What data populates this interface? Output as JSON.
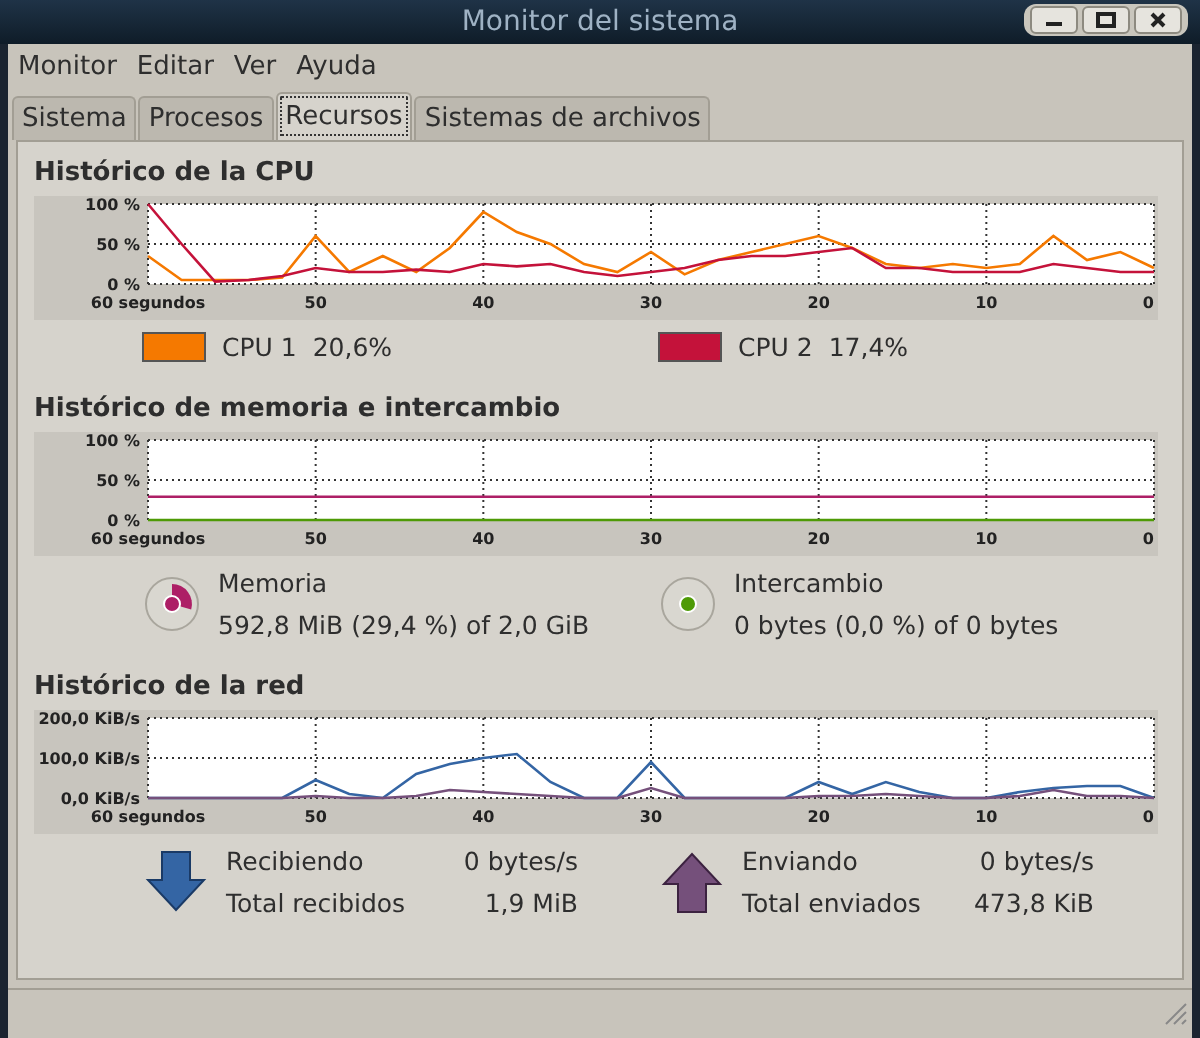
{
  "window": {
    "title": "Monitor del sistema"
  },
  "menu": [
    "Monitor",
    "Editar",
    "Ver",
    "Ayuda"
  ],
  "tabs": [
    {
      "label": "Sistema",
      "selected": false
    },
    {
      "label": "Procesos",
      "selected": false
    },
    {
      "label": "Recursos",
      "selected": true
    },
    {
      "label": "Sistemas de archivos",
      "selected": false
    }
  ],
  "sections": [
    {
      "kind": "cpu",
      "title": "Histórico de la CPU",
      "chart_data": {
        "type": "line",
        "grid": true,
        "x": [
          60,
          58,
          56,
          54,
          52,
          50,
          48,
          46,
          44,
          42,
          40,
          38,
          36,
          34,
          32,
          30,
          28,
          26,
          24,
          22,
          20,
          18,
          16,
          14,
          12,
          10,
          8,
          6,
          4,
          2,
          0
        ],
        "xlim": [
          60,
          0
        ],
        "ylim": [
          0,
          100
        ],
        "xticks": [
          {
            "value": 60,
            "label": "60 segundos"
          },
          {
            "value": 50,
            "label": "50"
          },
          {
            "value": 40,
            "label": "40"
          },
          {
            "value": 30,
            "label": "30"
          },
          {
            "value": 20,
            "label": "20"
          },
          {
            "value": 10,
            "label": "10"
          },
          {
            "value": 0,
            "label": "0"
          }
        ],
        "yticks": [
          {
            "value": 0,
            "label": "0 %"
          },
          {
            "value": 50,
            "label": "50 %"
          },
          {
            "value": 100,
            "label": "100 %"
          }
        ],
        "series": [
          {
            "name": "CPU 1",
            "color": "#f57900",
            "values": [
              35,
              5,
              5,
              5,
              8,
              60,
              15,
              35,
              15,
              45,
              90,
              65,
              50,
              25,
              15,
              40,
              12,
              30,
              40,
              50,
              60,
              45,
              25,
              20,
              25,
              20,
              25,
              60,
              30,
              40,
              20
            ]
          },
          {
            "name": "CPU 2",
            "color": "#c4123a",
            "values": [
              100,
              50,
              3,
              5,
              10,
              20,
              15,
              15,
              18,
              15,
              25,
              22,
              25,
              15,
              10,
              15,
              20,
              30,
              35,
              35,
              40,
              45,
              20,
              20,
              15,
              15,
              15,
              25,
              20,
              15,
              15
            ]
          }
        ]
      },
      "legend": [
        {
          "value": "20,6%"
        },
        {
          "value": "17,4%"
        }
      ]
    },
    {
      "kind": "memory",
      "title": "Histórico de memoria e intercambio",
      "chart_data": {
        "type": "line",
        "grid": true,
        "x": [
          60,
          0
        ],
        "xlim": [
          60,
          0
        ],
        "ylim": [
          0,
          100
        ],
        "xticks": [
          {
            "value": 60,
            "label": "60 segundos"
          },
          {
            "value": 50,
            "label": "50"
          },
          {
            "value": 40,
            "label": "40"
          },
          {
            "value": 30,
            "label": "30"
          },
          {
            "value": 20,
            "label": "20"
          },
          {
            "value": 10,
            "label": "10"
          },
          {
            "value": 0,
            "label": "0"
          }
        ],
        "yticks": [
          {
            "value": 0,
            "label": "0 %"
          },
          {
            "value": 50,
            "label": "50 %"
          },
          {
            "value": 100,
            "label": "100 %"
          }
        ],
        "series": [
          {
            "name": "Memoria",
            "color": "#ad1f66",
            "values": [
              29,
              29
            ]
          },
          {
            "name": "Intercambio",
            "color": "#4e9a06",
            "values": [
              0,
              0
            ]
          }
        ]
      },
      "legend": [
        {
          "value": "592,8 MiB (29,4 %) of 2,0 GiB"
        },
        {
          "value": "0 bytes (0,0 %) of 0 bytes"
        }
      ]
    },
    {
      "kind": "network",
      "title": "Histórico de la red",
      "chart_data": {
        "type": "line",
        "grid": true,
        "x": [
          60,
          58,
          56,
          54,
          52,
          50,
          48,
          46,
          44,
          42,
          40,
          38,
          36,
          34,
          32,
          30,
          28,
          26,
          24,
          22,
          20,
          18,
          16,
          14,
          12,
          10,
          8,
          6,
          4,
          2,
          0
        ],
        "xlim": [
          60,
          0
        ],
        "ylim": [
          0,
          200
        ],
        "xticks": [
          {
            "value": 60,
            "label": "60 segundos"
          },
          {
            "value": 50,
            "label": "50"
          },
          {
            "value": 40,
            "label": "40"
          },
          {
            "value": 30,
            "label": "30"
          },
          {
            "value": 20,
            "label": "20"
          },
          {
            "value": 10,
            "label": "10"
          },
          {
            "value": 0,
            "label": "0"
          }
        ],
        "yticks": [
          {
            "value": 0,
            "label": "0,0 KiB/s"
          },
          {
            "value": 100,
            "label": "100,0 KiB/s"
          },
          {
            "value": 200,
            "label": "200,0 KiB/s"
          }
        ],
        "series": [
          {
            "name": "Recibiendo",
            "color": "#3465a4",
            "values": [
              0,
              0,
              0,
              0,
              0,
              45,
              10,
              0,
              60,
              85,
              100,
              110,
              40,
              0,
              0,
              90,
              0,
              0,
              0,
              0,
              40,
              10,
              40,
              15,
              0,
              0,
              15,
              25,
              30,
              30,
              0
            ]
          },
          {
            "name": "Enviando",
            "color": "#75507b",
            "values": [
              0,
              0,
              0,
              0,
              0,
              5,
              0,
              0,
              5,
              20,
              15,
              10,
              5,
              0,
              0,
              25,
              0,
              0,
              0,
              0,
              5,
              5,
              10,
              5,
              0,
              0,
              5,
              20,
              5,
              5,
              0
            ]
          }
        ]
      },
      "legend": [
        {
          "value": "0 bytes/s",
          "total_label": "Total recibidos",
          "total": "1,9 MiB"
        },
        {
          "value": "0 bytes/s",
          "total_label": "Total enviados",
          "total": "473,8 KiB"
        }
      ]
    }
  ]
}
